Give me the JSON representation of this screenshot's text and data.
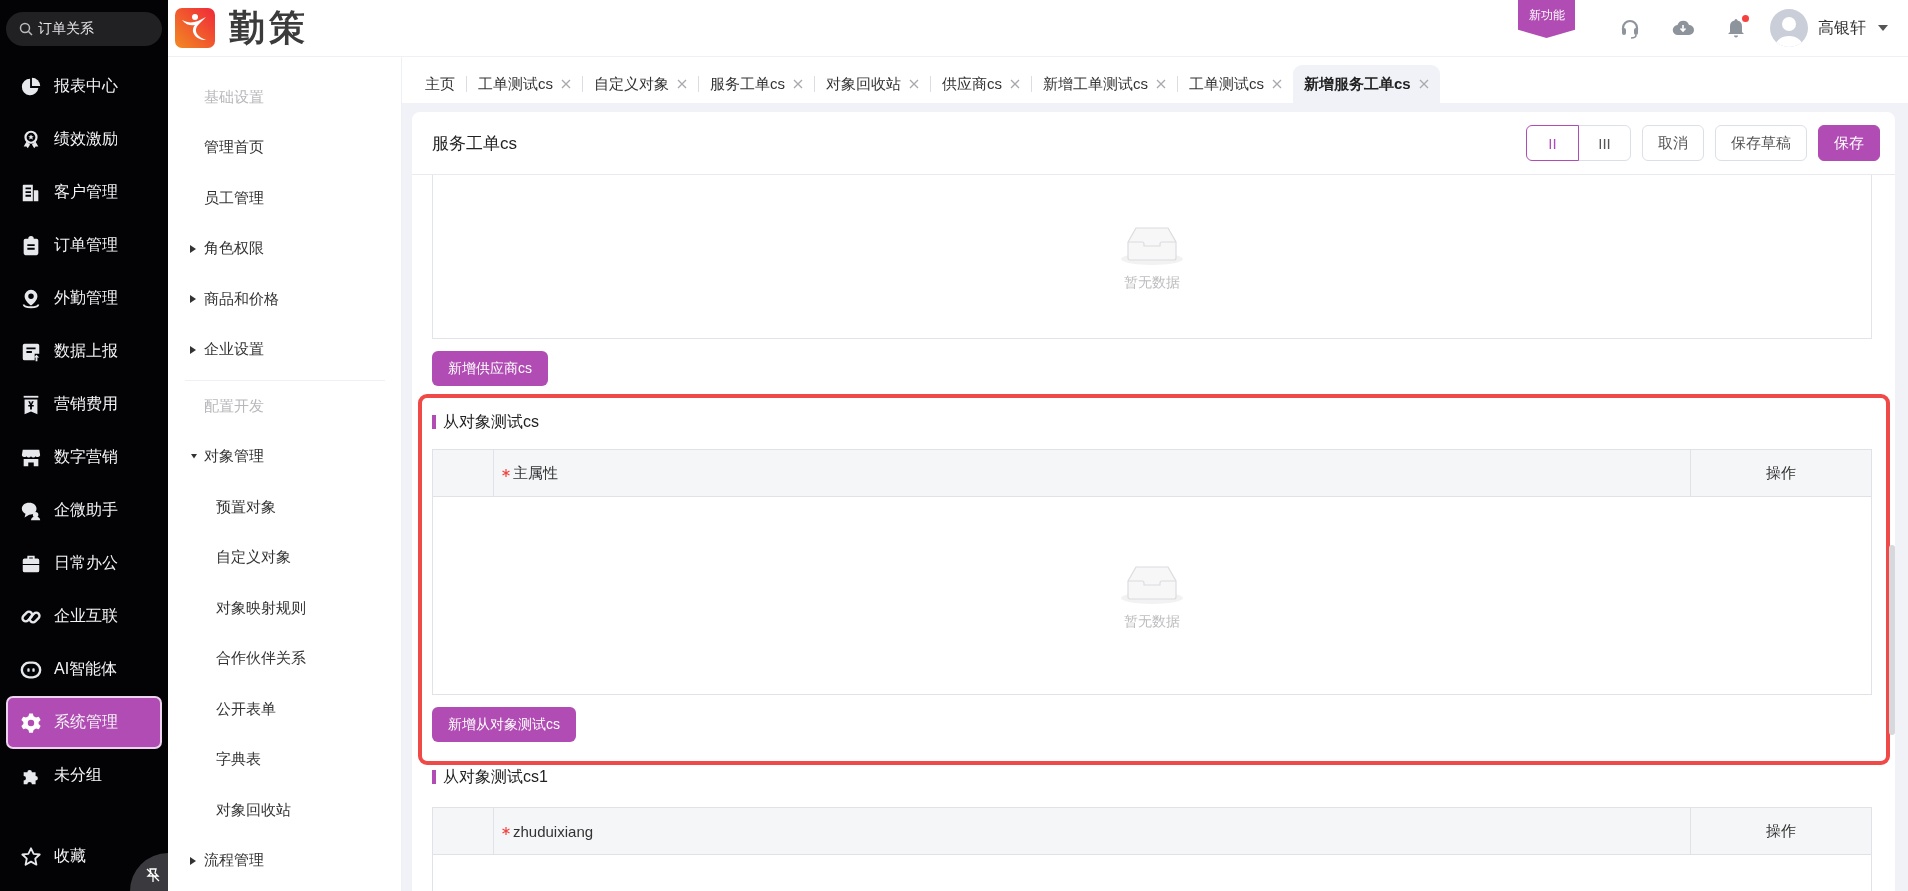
{
  "nav_search": {
    "value": "订单关系"
  },
  "nav": [
    {
      "label": "报表中心",
      "selected": false
    },
    {
      "label": "绩效激励",
      "selected": false
    },
    {
      "label": "客户管理",
      "selected": false
    },
    {
      "label": "订单管理",
      "selected": false
    },
    {
      "label": "外勤管理",
      "selected": false
    },
    {
      "label": "数据上报",
      "selected": false
    },
    {
      "label": "营销费用",
      "selected": false
    },
    {
      "label": "数字营销",
      "selected": false
    },
    {
      "label": "企微助手",
      "selected": false
    },
    {
      "label": "日常办公",
      "selected": false
    },
    {
      "label": "企业互联",
      "selected": false
    },
    {
      "label": "AI智能体",
      "selected": false
    },
    {
      "label": "系统管理",
      "selected": true
    },
    {
      "label": "未分组",
      "selected": false
    }
  ],
  "nav_footer": {
    "label": "收藏"
  },
  "logo": {
    "text": "勤策"
  },
  "header": {
    "badge": "新功能",
    "unread": true,
    "user": "高银轩"
  },
  "menu": [
    {
      "kind": "heading",
      "label": "基础设置"
    },
    {
      "kind": "link",
      "label": "管理首页"
    },
    {
      "kind": "link",
      "label": "员工管理"
    },
    {
      "kind": "group",
      "label": "角色权限",
      "expanded": false
    },
    {
      "kind": "group",
      "label": "商品和价格",
      "expanded": false
    },
    {
      "kind": "group",
      "label": "企业设置",
      "expanded": false
    },
    {
      "kind": "divider"
    },
    {
      "kind": "heading",
      "label": "配置开发"
    },
    {
      "kind": "group",
      "label": "对象管理",
      "expanded": true,
      "children": [
        {
          "label": "预置对象"
        },
        {
          "label": "自定义对象"
        },
        {
          "label": "对象映射规则"
        },
        {
          "label": "合作伙伴关系"
        },
        {
          "label": "公开表单"
        },
        {
          "label": "字典表"
        },
        {
          "label": "对象回收站"
        }
      ]
    },
    {
      "kind": "group",
      "label": "流程管理",
      "expanded": false
    }
  ],
  "tabs": [
    {
      "label": "主页",
      "closable": false,
      "selected": false
    },
    {
      "label": "工单测试cs",
      "closable": true,
      "selected": false
    },
    {
      "label": "自定义对象",
      "closable": true,
      "selected": false
    },
    {
      "label": "服务工单cs",
      "closable": true,
      "selected": false
    },
    {
      "label": "对象回收站",
      "closable": true,
      "selected": false
    },
    {
      "label": "供应商cs",
      "closable": true,
      "selected": false
    },
    {
      "label": "新增工单测试cs",
      "closable": true,
      "selected": false
    },
    {
      "label": "工单测试cs",
      "closable": true,
      "selected": false
    },
    {
      "label": "新增服务工单cs",
      "closable": true,
      "selected": true
    }
  ],
  "form": {
    "title": "服务工单cs",
    "layouts": [
      {
        "label": "II",
        "selected": true
      },
      {
        "label": "III",
        "selected": false
      }
    ],
    "actions": [
      {
        "label": "取消",
        "kind": "secondary"
      },
      {
        "label": "保存草稿",
        "kind": "secondary"
      },
      {
        "label": "保存",
        "kind": "primary"
      }
    ]
  },
  "sections": [
    {
      "kind": "partial",
      "empty_text": "暂无数据",
      "add_button": "新增供应商cs"
    },
    {
      "kind": "table",
      "title": "从对象测试cs",
      "highlighted": true,
      "columns": [
        {
          "label": "主属性",
          "required": true
        },
        {
          "label": "操作",
          "required": false
        }
      ],
      "empty_text": "暂无数据",
      "add_button": "新增从对象测试cs"
    },
    {
      "kind": "table",
      "title": "从对象测试cs1",
      "highlighted": false,
      "columns": [
        {
          "label": "zhuduixiang",
          "required": true
        },
        {
          "label": "操作",
          "required": false
        }
      ]
    }
  ]
}
